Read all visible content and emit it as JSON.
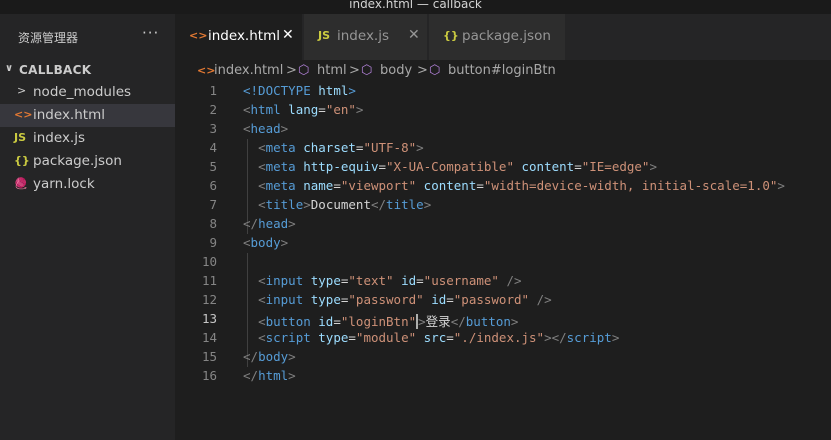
{
  "window": {
    "title": "index.html — callback"
  },
  "explorer": {
    "header": "资源管理器",
    "more": "···",
    "folder": "CALLBACK",
    "items": [
      {
        "icon": "chevron-right",
        "glyph": ">",
        "label": "node_modules",
        "color": "#cccccc"
      },
      {
        "icon": "html-file-icon",
        "glyph": "<>",
        "label": "index.html",
        "color": "#e37933",
        "active": true
      },
      {
        "icon": "js-file-icon",
        "glyph": "JS",
        "label": "index.js",
        "color": "#cbcb41"
      },
      {
        "icon": "json-file-icon",
        "glyph": "{}",
        "label": "package.json",
        "color": "#cbcb41"
      },
      {
        "icon": "yarn-file-icon",
        "glyph": "🧶",
        "label": "yarn.lock",
        "color": "#2c8ebb"
      }
    ]
  },
  "tabs": [
    {
      "glyph": "<>",
      "label": "index.html",
      "close": "✕",
      "color": "#e37933",
      "active": true
    },
    {
      "glyph": "JS",
      "label": "index.js",
      "close": "✕",
      "color": "#cbcb41",
      "active": false
    },
    {
      "glyph": "{}",
      "label": "package.json",
      "close": "",
      "color": "#cbcb41",
      "active": false
    }
  ],
  "breadcrumb": {
    "file": "index.html",
    "sep": ">",
    "items": [
      "html",
      "body",
      "button#loginBtn"
    ]
  },
  "editor": {
    "current_line": 13,
    "lines": [
      {
        "n": "1",
        "tokens": [
          [
            "t-tag",
            "<!DOCTYPE "
          ],
          [
            "t-attr",
            "html"
          ],
          [
            "t-tag",
            ">"
          ]
        ]
      },
      {
        "n": "2",
        "tokens": [
          [
            "t-punc",
            "<"
          ],
          [
            "t-tag",
            "html "
          ],
          [
            "t-attr",
            "lang"
          ],
          [
            "t-text",
            "="
          ],
          [
            "t-str",
            "\"en\""
          ],
          [
            "t-punc",
            ">"
          ]
        ]
      },
      {
        "n": "3",
        "tokens": [
          [
            "t-punc",
            "<"
          ],
          [
            "t-tag",
            "head"
          ],
          [
            "t-punc",
            ">"
          ]
        ]
      },
      {
        "n": "4",
        "tokens": [
          [
            "t-text",
            "  "
          ],
          [
            "t-punc",
            "<"
          ],
          [
            "t-tag",
            "meta "
          ],
          [
            "t-attr",
            "charset"
          ],
          [
            "t-text",
            "="
          ],
          [
            "t-str",
            "\"UTF-8\""
          ],
          [
            "t-punc",
            ">"
          ]
        ]
      },
      {
        "n": "5",
        "tokens": [
          [
            "t-text",
            "  "
          ],
          [
            "t-punc",
            "<"
          ],
          [
            "t-tag",
            "meta "
          ],
          [
            "t-attr",
            "http-equiv"
          ],
          [
            "t-text",
            "="
          ],
          [
            "t-str",
            "\"X-UA-Compatible\" "
          ],
          [
            "t-attr",
            "content"
          ],
          [
            "t-text",
            "="
          ],
          [
            "t-str",
            "\"IE=edge\""
          ],
          [
            "t-punc",
            ">"
          ]
        ]
      },
      {
        "n": "6",
        "tokens": [
          [
            "t-text",
            "  "
          ],
          [
            "t-punc",
            "<"
          ],
          [
            "t-tag",
            "meta "
          ],
          [
            "t-attr",
            "name"
          ],
          [
            "t-text",
            "="
          ],
          [
            "t-str",
            "\"viewport\" "
          ],
          [
            "t-attr",
            "content"
          ],
          [
            "t-text",
            "="
          ],
          [
            "t-str",
            "\"width=device-width, initial-scale=1.0\""
          ],
          [
            "t-punc",
            ">"
          ]
        ]
      },
      {
        "n": "7",
        "tokens": [
          [
            "t-text",
            "  "
          ],
          [
            "t-punc",
            "<"
          ],
          [
            "t-tag",
            "title"
          ],
          [
            "t-punc",
            ">"
          ],
          [
            "t-text",
            "Document"
          ],
          [
            "t-punc",
            "</"
          ],
          [
            "t-tag",
            "title"
          ],
          [
            "t-punc",
            ">"
          ]
        ]
      },
      {
        "n": "8",
        "tokens": [
          [
            "t-punc",
            "</"
          ],
          [
            "t-tag",
            "head"
          ],
          [
            "t-punc",
            ">"
          ]
        ]
      },
      {
        "n": "9",
        "tokens": [
          [
            "t-punc",
            "<"
          ],
          [
            "t-tag",
            "body"
          ],
          [
            "t-punc",
            ">"
          ]
        ]
      },
      {
        "n": "10",
        "tokens": []
      },
      {
        "n": "11",
        "tokens": [
          [
            "t-text",
            "  "
          ],
          [
            "t-punc",
            "<"
          ],
          [
            "t-tag",
            "input "
          ],
          [
            "t-attr",
            "type"
          ],
          [
            "t-text",
            "="
          ],
          [
            "t-str",
            "\"text\" "
          ],
          [
            "t-attr",
            "id"
          ],
          [
            "t-text",
            "="
          ],
          [
            "t-str",
            "\"username\" "
          ],
          [
            "t-punc",
            "/>"
          ]
        ]
      },
      {
        "n": "12",
        "tokens": [
          [
            "t-text",
            "  "
          ],
          [
            "t-punc",
            "<"
          ],
          [
            "t-tag",
            "input "
          ],
          [
            "t-attr",
            "type"
          ],
          [
            "t-text",
            "="
          ],
          [
            "t-str",
            "\"password\" "
          ],
          [
            "t-attr",
            "id"
          ],
          [
            "t-text",
            "="
          ],
          [
            "t-str",
            "\"password\" "
          ],
          [
            "t-punc",
            "/>"
          ]
        ]
      },
      {
        "n": "13",
        "tokens": [
          [
            "t-text",
            "  "
          ],
          [
            "t-punc",
            "<"
          ],
          [
            "t-tag",
            "button "
          ],
          [
            "t-attr",
            "id"
          ],
          [
            "t-text",
            "="
          ],
          [
            "t-str",
            "\"loginBtn\""
          ],
          [
            "cursor",
            ""
          ],
          [
            "t-punc",
            ">"
          ],
          [
            "t-text",
            "登录"
          ],
          [
            "t-punc",
            "</"
          ],
          [
            "t-tag",
            "button"
          ],
          [
            "t-punc",
            ">"
          ]
        ]
      },
      {
        "n": "14",
        "tokens": [
          [
            "t-text",
            "  "
          ],
          [
            "t-punc",
            "<"
          ],
          [
            "t-tag",
            "script "
          ],
          [
            "t-attr",
            "type"
          ],
          [
            "t-text",
            "="
          ],
          [
            "t-str",
            "\"module\" "
          ],
          [
            "t-attr",
            "src"
          ],
          [
            "t-text",
            "="
          ],
          [
            "t-str",
            "\"./index.js\""
          ],
          [
            "t-punc",
            "></"
          ],
          [
            "t-tag",
            "script"
          ],
          [
            "t-punc",
            ">"
          ]
        ]
      },
      {
        "n": "15",
        "tokens": [
          [
            "t-punc",
            "</"
          ],
          [
            "t-tag",
            "body"
          ],
          [
            "t-punc",
            ">"
          ]
        ]
      },
      {
        "n": "16",
        "tokens": [
          [
            "t-punc",
            "</"
          ],
          [
            "t-tag",
            "html"
          ],
          [
            "t-punc",
            ">"
          ]
        ]
      }
    ]
  }
}
